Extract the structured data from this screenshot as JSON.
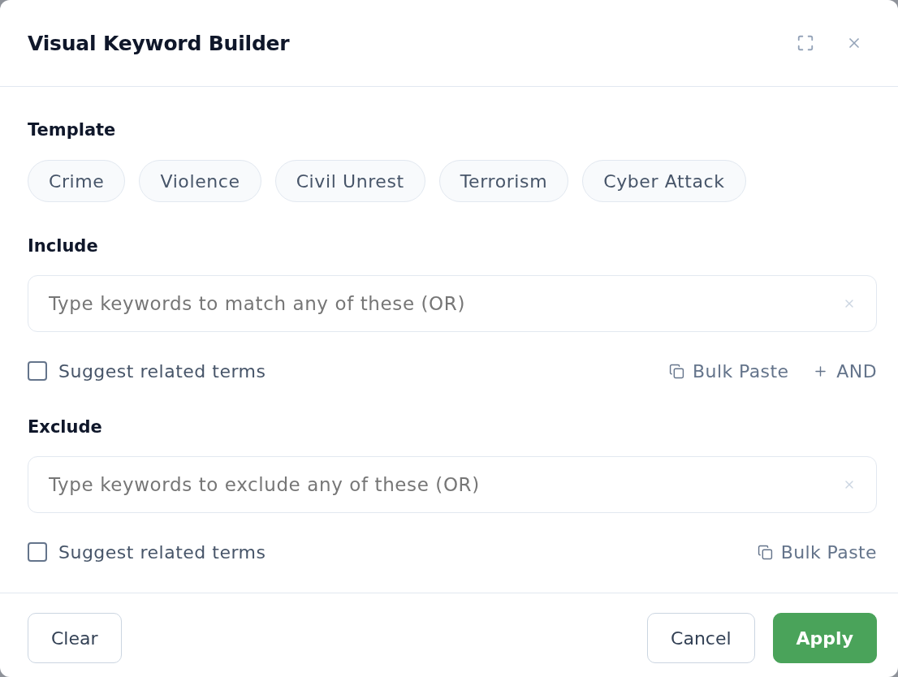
{
  "dialog": {
    "title": "Visual Keyword Builder"
  },
  "template": {
    "label": "Template",
    "chips": [
      {
        "label": "Crime"
      },
      {
        "label": "Violence"
      },
      {
        "label": "Civil Unrest"
      },
      {
        "label": "Terrorism"
      },
      {
        "label": "Cyber Attack"
      }
    ]
  },
  "include": {
    "label": "Include",
    "placeholder": "Type keywords to match any of these (OR)",
    "suggest": {
      "label": "Suggest related terms",
      "checked": false
    },
    "actions": [
      {
        "kind": "paste",
        "label": "Bulk Paste"
      },
      {
        "kind": "add",
        "label": "AND"
      }
    ]
  },
  "exclude": {
    "label": "Exclude",
    "placeholder": "Type keywords to exclude any of these (OR)",
    "suggest": {
      "label": "Suggest related terms",
      "checked": false
    },
    "actions": [
      {
        "kind": "paste",
        "label": "Bulk Paste"
      }
    ]
  },
  "footer": {
    "left_buttons": [
      {
        "kind": "outline",
        "label": "Clear"
      }
    ],
    "right_buttons": [
      {
        "kind": "outline",
        "label": "Cancel"
      },
      {
        "kind": "primary",
        "label": "Apply"
      }
    ]
  }
}
